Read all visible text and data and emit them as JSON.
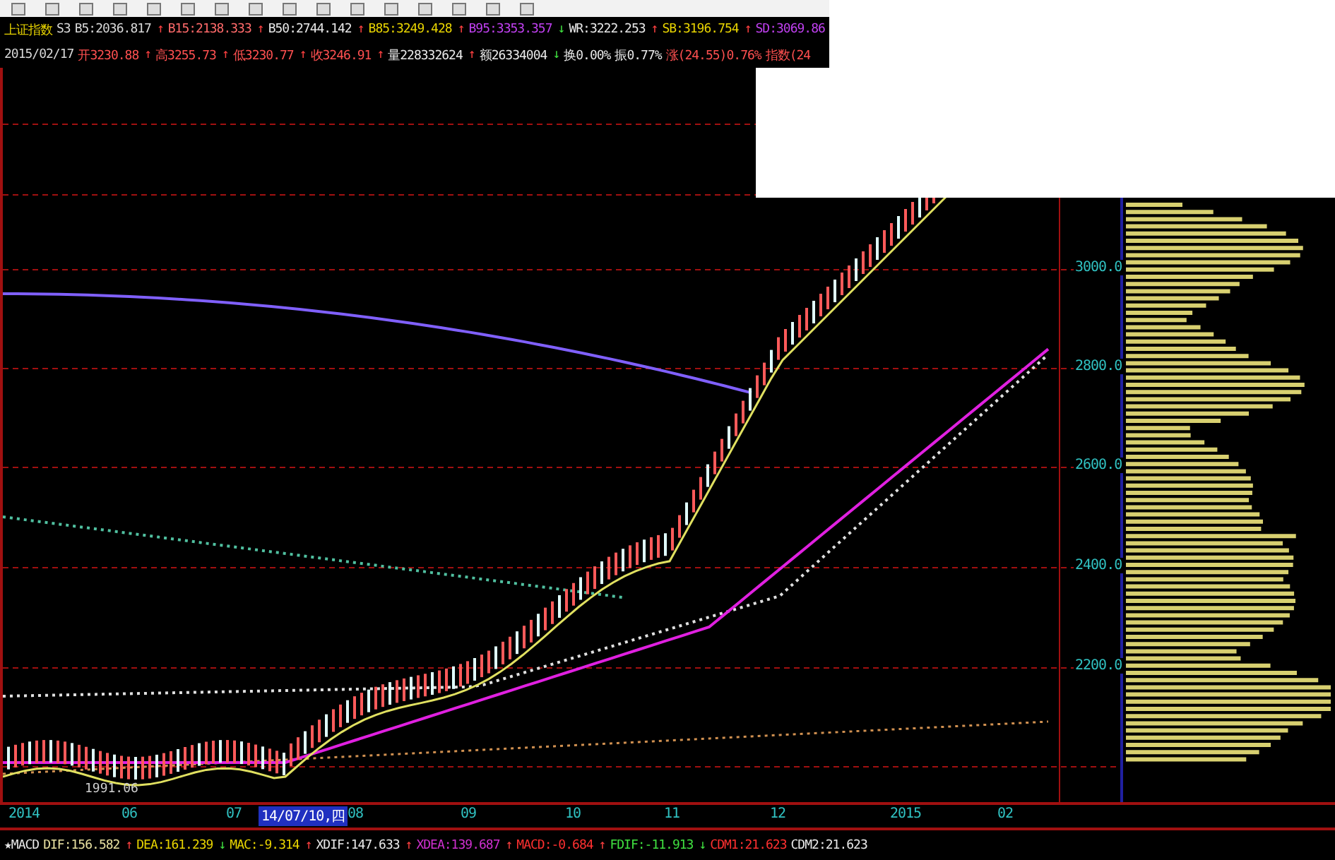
{
  "quote_rows": [
    [
      {
        "text": "上证指数",
        "color": "#e8d400"
      },
      {
        "text": "S3",
        "color": "#d8d8d8"
      },
      {
        "text": "B5:2036.817",
        "color": "#d8d8d8",
        "arrow": "↑"
      },
      {
        "text": "B15:2138.333",
        "color": "#ff6a6a",
        "arrow": "↑"
      },
      {
        "text": "B50:2744.142",
        "color": "#e8e8e8",
        "arrow": "↑"
      },
      {
        "text": "B85:3249.428",
        "color": "#e8d400",
        "arrow": "↑"
      },
      {
        "text": "B95:3353.357",
        "color": "#c040f0",
        "arrow": "↓"
      },
      {
        "text": "WR:3222.253",
        "color": "#e8e8e8",
        "arrow": "↑"
      },
      {
        "text": "SB:3196.754",
        "color": "#e8d400",
        "arrow": "↑"
      },
      {
        "text": "SD:3069.86",
        "color": "#c040f0"
      }
    ],
    [
      {
        "text": "2015/02/17",
        "color": "#d8d8d8"
      },
      {
        "text": "开3230.88",
        "color": "#ff5050",
        "arrow": "↑"
      },
      {
        "text": "高3255.73",
        "color": "#ff5050",
        "arrow": "↑"
      },
      {
        "text": "低3230.77",
        "color": "#ff5050",
        "arrow": "↑"
      },
      {
        "text": "收3246.91",
        "color": "#ff5050",
        "arrow": "↑"
      },
      {
        "text": "量228332624",
        "color": "#e8e8e8",
        "arrow": "↑"
      },
      {
        "text": "额26334004",
        "color": "#e8e8e8",
        "arrow": "↓"
      },
      {
        "text": "换0.00%",
        "color": "#e8e8e8"
      },
      {
        "text": "振0.77%",
        "color": "#e8e8e8"
      },
      {
        "text": "涨(24.55)0.76%",
        "color": "#ff5050"
      },
      {
        "text": "指数(24",
        "color": "#ff5050"
      }
    ]
  ],
  "price_axis": [
    "3000.0",
    "2800.0",
    "2600.0",
    "2400.0",
    "2200.0"
  ],
  "low_marker": "1991.06",
  "date_axis": [
    {
      "label": "2014",
      "selected": false
    },
    {
      "label": "06",
      "selected": false
    },
    {
      "label": "07",
      "selected": false
    },
    {
      "label": "14/07/10,四",
      "selected": true
    },
    {
      "label": "08",
      "selected": false
    },
    {
      "label": "09",
      "selected": false
    },
    {
      "label": "10",
      "selected": false
    },
    {
      "label": "11",
      "selected": false
    },
    {
      "label": "12",
      "selected": false
    },
    {
      "label": "2015",
      "selected": false
    },
    {
      "label": "02",
      "selected": false
    }
  ],
  "indicator_row": [
    {
      "text": "★MACD",
      "color": "#e8e8e8"
    },
    {
      "text": "DIF:156.582",
      "color": "#e8e0a0",
      "arrow": "↑"
    },
    {
      "text": "DEA:161.239",
      "color": "#e8d400",
      "arrow": "↓"
    },
    {
      "text": "MAC:-9.314",
      "color": "#e8d400",
      "arrow": "↑"
    },
    {
      "text": "XDIF:147.633",
      "color": "#e8e8e8",
      "arrow": "↑"
    },
    {
      "text": "XDEA:139.687",
      "color": "#d030d0",
      "arrow": "↑"
    },
    {
      "text": "MACD:-0.684",
      "color": "#ff3030",
      "arrow": "↑"
    },
    {
      "text": "FDIF:-11.913",
      "color": "#40e040",
      "arrow": "↓"
    },
    {
      "text": "CDM1:21.623",
      "color": "#ff3030"
    },
    {
      "text": "CDM2:21.623",
      "color": "#e8e8e8"
    }
  ]
}
